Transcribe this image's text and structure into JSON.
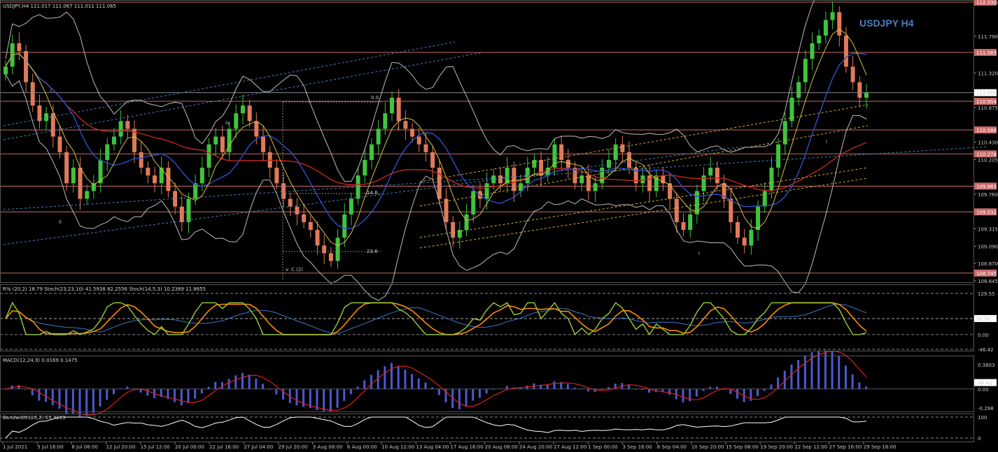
{
  "symbol_title": "USDJPY H4",
  "main_header": "USDJPY,H4  111.017 111.067 111.011 111.065",
  "price_labels": [
    "112.230",
    "111.790",
    "111.320",
    "110.875",
    "110.430",
    "110.205",
    "109.760",
    "109.315",
    "109.090",
    "108.870",
    "108.645"
  ],
  "hline_labels": [
    "112.230",
    "111.583",
    "110.954",
    "110.586",
    "110.278",
    "109.863",
    "109.532",
    "108.745"
  ],
  "current_price": "111.065",
  "fib_labels": [
    "0.0",
    "14.6",
    "23.6"
  ],
  "wave_labels": [
    "i",
    "ii",
    "iv",
    "i",
    "v",
    "C (2)",
    "i",
    "i"
  ],
  "stoch_header": "R% (20,2) 18.79  Stoch(23,23,10) 41.5938 82.2556  Stoch(14,5,3) 10.2389 11.8655",
  "stoch_scale": [
    "129.55",
    "50.50",
    "0.00",
    "-46.42"
  ],
  "stoch_tag": "50.50",
  "macd_header": "MACD(12,24,9) 0.0169 0.1475",
  "macd_scale": [
    "0.3803",
    "0.00",
    "-0.298"
  ],
  "macd_tag": "-46.42",
  "bw_header": "Bandwidth(20,2) 55.3113",
  "bw_scale": [
    "100",
    "0"
  ],
  "time_labels": [
    "1 Jul 2021",
    "5 Jul 16:00",
    "8 Jul 08:00",
    "12 Jul 20:00",
    "15 Jul 12:00",
    "20 Jul 00:00",
    "22 Jul 16:00",
    "27 Jul 04:00",
    "29 Jul 20:00",
    "3 Aug 08:00",
    "6 Aug 00:00",
    "10 Aug 12:00",
    "13 Aug 04:00",
    "17 Aug 16:00",
    "20 Aug 08:00",
    "24 Aug 20:00",
    "27 Aug 12:00",
    "1 Sep 00:00",
    "3 Sep 16:00",
    "8 Sep 04:00",
    "10 Sep 20:00",
    "15 Sep 08:00",
    "19 Sep 20:00",
    "22 Sep 12:00",
    "27 Sep 16:00",
    "29 Sep 16:00"
  ],
  "colors": {
    "bull": "#3fc43f",
    "bear": "#e07a5a",
    "hline": "#c96a6a",
    "ma_red": "#c0281e",
    "ma_blue": "#3050c8",
    "ma_yellow": "#d8c040",
    "band": "#bcbcbc",
    "stoch_green": "#9acd32",
    "stoch_orange": "#ff8c00",
    "macd_hist": "#4a5ad0",
    "macd_signal": "#dd1f1f"
  },
  "chart_data": {
    "type": "candlestick",
    "title": "USDJPY H4",
    "ylim": [
      108.645,
      112.23
    ],
    "closes": [
      111.4,
      111.7,
      111.6,
      111.2,
      110.9,
      110.7,
      110.8,
      110.5,
      110.3,
      109.9,
      110.1,
      109.7,
      109.8,
      109.9,
      110.2,
      110.4,
      110.5,
      110.7,
      110.6,
      110.3,
      110.1,
      110.0,
      109.9,
      110.1,
      109.8,
      109.6,
      109.4,
      109.7,
      109.9,
      110.1,
      110.4,
      110.5,
      110.3,
      110.6,
      110.8,
      110.9,
      110.7,
      110.5,
      110.3,
      110.1,
      109.9,
      109.7,
      109.6,
      109.5,
      109.4,
      109.3,
      109.1,
      109.0,
      108.9,
      109.2,
      109.5,
      109.7,
      110.0,
      110.2,
      110.4,
      110.6,
      110.8,
      111.0,
      110.7,
      110.6,
      110.5,
      110.4,
      110.3,
      110.1,
      109.7,
      109.4,
      109.2,
      109.3,
      109.5,
      109.8,
      109.7,
      109.9,
      110.0,
      109.9,
      110.1,
      109.8,
      109.9,
      110.1,
      110.2,
      110.0,
      110.1,
      110.4,
      110.2,
      110.1,
      109.9,
      110.0,
      109.8,
      109.9,
      110.1,
      110.2,
      110.4,
      110.3,
      110.1,
      109.9,
      110.0,
      109.8,
      110.0,
      109.9,
      109.7,
      109.4,
      109.3,
      109.5,
      109.8,
      110.0,
      110.1,
      109.9,
      109.7,
      109.4,
      109.2,
      109.1,
      109.3,
      109.6,
      109.8,
      110.1,
      110.4,
      110.7,
      111.0,
      111.2,
      111.5,
      111.7,
      111.8,
      112.0,
      112.1,
      111.8,
      111.4,
      111.2,
      111.0,
      111.065
    ]
  }
}
